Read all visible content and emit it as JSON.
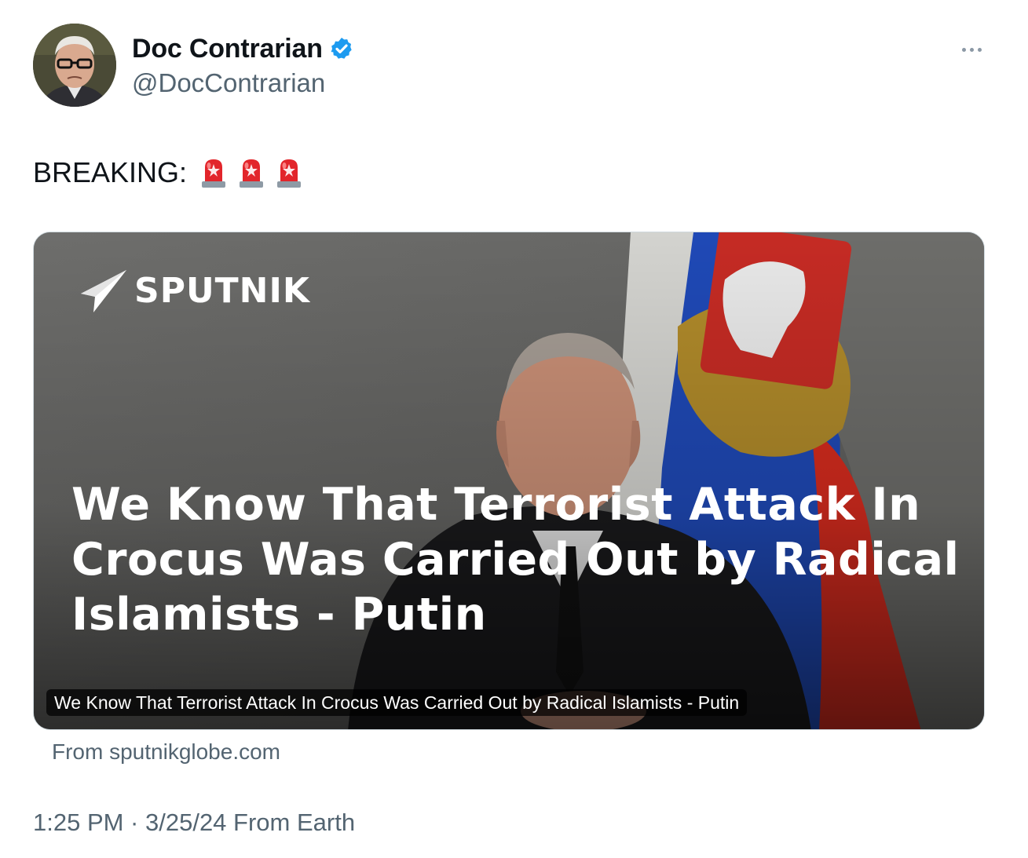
{
  "author": {
    "display_name": "Doc Contrarian",
    "handle": "@DocContrarian",
    "verified": true,
    "avatar_icon": "avatar-portrait"
  },
  "menu": {
    "more_icon": "more-horizontal-icon"
  },
  "tweet": {
    "text": "BREAKING:",
    "emoji": [
      "siren",
      "siren",
      "siren"
    ]
  },
  "card": {
    "brand": "SPUTNIK",
    "headline": "We Know That Terrorist Attack In Crocus Was Carried Out by Radical Islamists - Putin",
    "caption": "We Know That Terrorist Attack In Crocus Was Carried Out by Radical Islamists - Putin",
    "source": "From sputnikglobe.com"
  },
  "meta": {
    "timestamp": "1:25 PM · 3/25/24 From Earth"
  },
  "colors": {
    "verified": "#1d9bf0",
    "secondary_text": "#536471",
    "flag_white": "#ffffff",
    "flag_blue": "#1f49b6",
    "flag_red": "#d52b1e"
  }
}
